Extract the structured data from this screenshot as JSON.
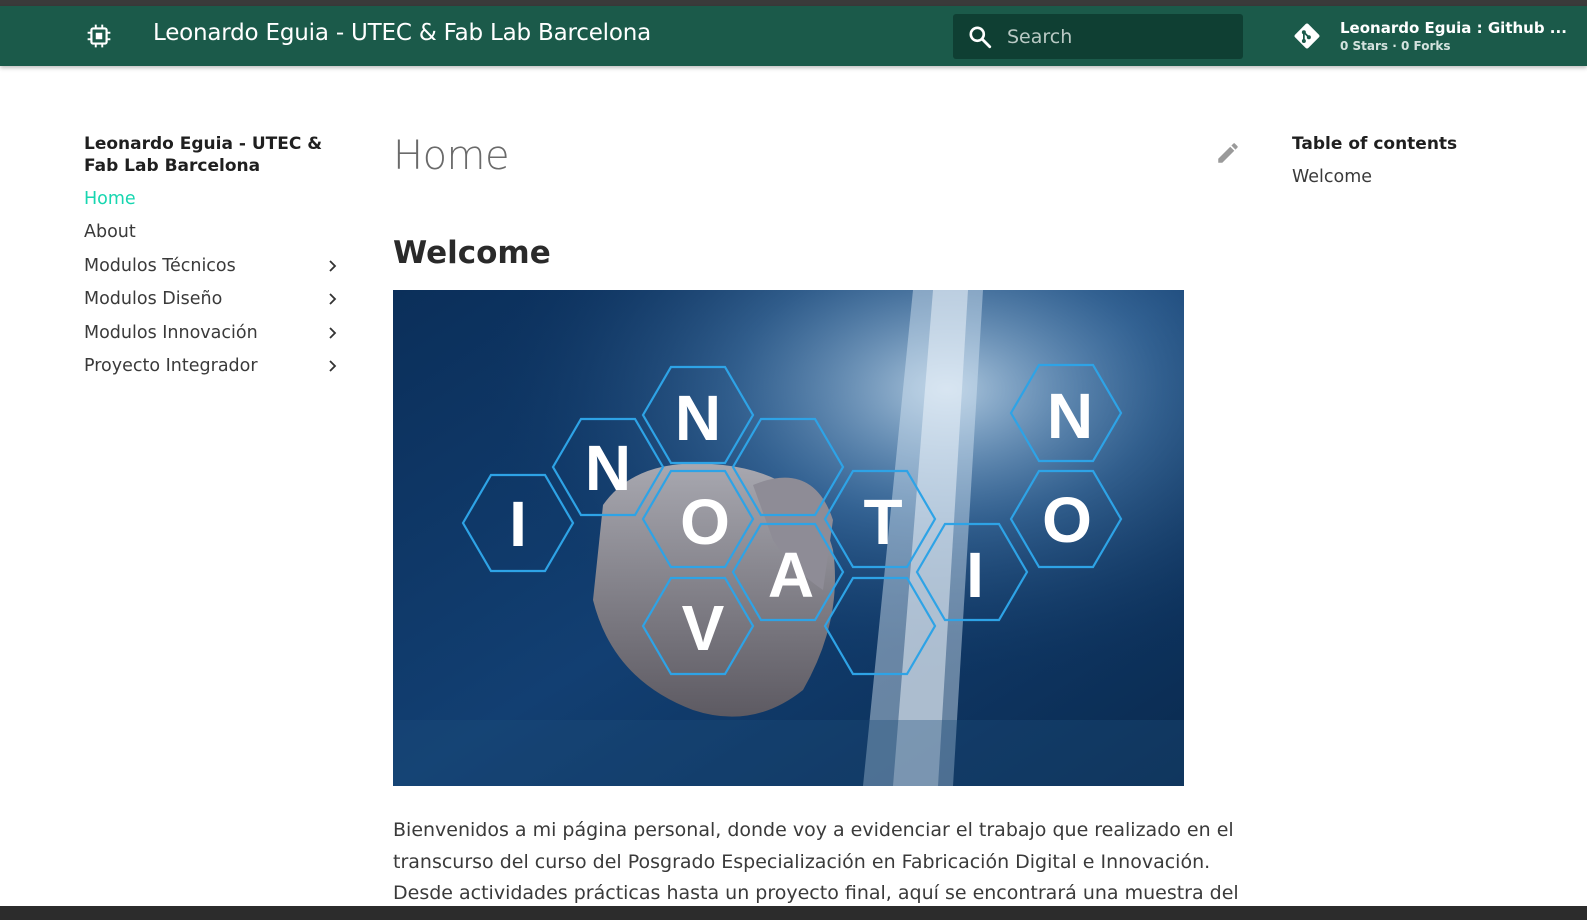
{
  "header": {
    "logo_icon": "chip-icon",
    "site_title": "Leonardo Eguia - UTEC & Fab Lab Barcelona",
    "search_placeholder": "Search",
    "repo_name": "Leonardo Eguia : Github ...",
    "repo_facts": "0 Stars · 0 Forks",
    "colors": {
      "header_bg": "#1b5a4a",
      "search_bg": "#0f3f33"
    }
  },
  "nav": {
    "title": "Leonardo Eguia - UTEC & Fab Lab Barcelona",
    "items": [
      {
        "label": "Home",
        "active": true,
        "expandable": false
      },
      {
        "label": "About",
        "active": false,
        "expandable": false
      },
      {
        "label": "Modulos Técnicos",
        "active": false,
        "expandable": true
      },
      {
        "label": "Modulos Diseño",
        "active": false,
        "expandable": true
      },
      {
        "label": "Modulos Innovación",
        "active": false,
        "expandable": true
      },
      {
        "label": "Proyecto Integrador",
        "active": false,
        "expandable": true
      }
    ],
    "active_color": "#17d6b0"
  },
  "main": {
    "title": "Home",
    "section_heading": "Welcome",
    "hero_letters": [
      "I",
      "N",
      "N",
      "O",
      "V",
      "A",
      "T",
      "I",
      "O",
      "N"
    ],
    "paragraph": "Bienvenidos a mi página personal, donde voy a evidenciar el trabajo que realizado en el transcurso del curso del Posgrado Especialización en Fabricación Digital e Innovación. Desde actividades prácticas hasta un proyecto final, aquí se encontrará una muestra del"
  },
  "toc": {
    "title": "Table of contents",
    "items": [
      "Welcome"
    ]
  }
}
